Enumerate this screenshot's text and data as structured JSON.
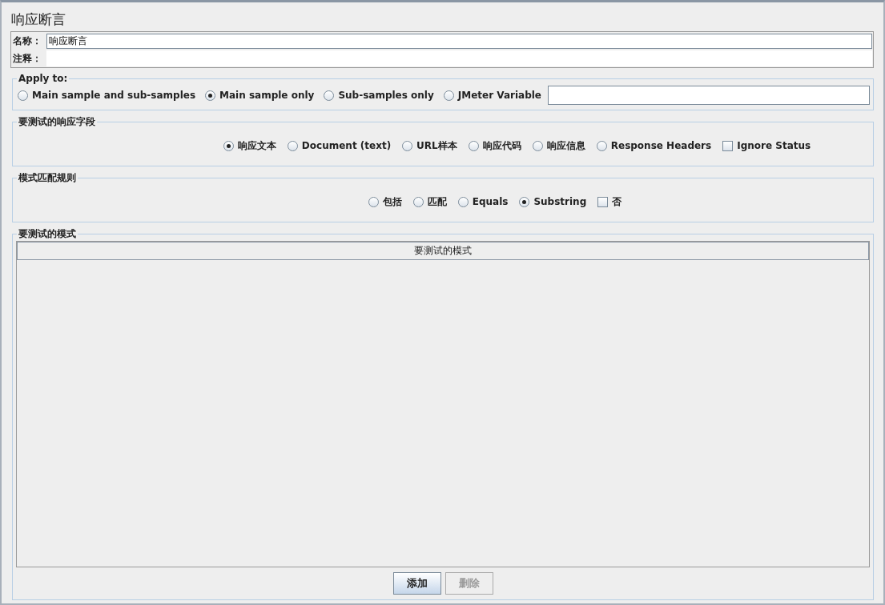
{
  "title": "响应断言",
  "name_field": {
    "label": "名称：",
    "value": "响应断言"
  },
  "comment_field": {
    "label": "注释："
  },
  "apply_to": {
    "legend": "Apply to:",
    "options": [
      {
        "kind": "radio",
        "label": "Main sample and sub-samples",
        "selected": false
      },
      {
        "kind": "radio",
        "label": "Main sample only",
        "selected": true
      },
      {
        "kind": "radio",
        "label": "Sub-samples only",
        "selected": false
      },
      {
        "kind": "radio",
        "label": "JMeter Variable",
        "selected": false
      }
    ]
  },
  "response_field": {
    "legend": "要测试的响应字段",
    "options": [
      {
        "kind": "radio",
        "label": "响应文本",
        "selected": true
      },
      {
        "kind": "radio",
        "label": "Document (text)",
        "selected": false
      },
      {
        "kind": "radio",
        "label": "URL样本",
        "selected": false
      },
      {
        "kind": "radio",
        "label": "响应代码",
        "selected": false
      },
      {
        "kind": "radio",
        "label": "响应信息",
        "selected": false
      },
      {
        "kind": "radio",
        "label": "Response Headers",
        "selected": false
      },
      {
        "kind": "checkbox",
        "label": "Ignore Status",
        "checked": false
      }
    ]
  },
  "pattern_rules": {
    "legend": "模式匹配规则",
    "options": [
      {
        "kind": "radio",
        "label": "包括",
        "selected": false
      },
      {
        "kind": "radio",
        "label": "匹配",
        "selected": false
      },
      {
        "kind": "radio",
        "label": "Equals",
        "selected": false
      },
      {
        "kind": "radio",
        "label": "Substring",
        "selected": true
      },
      {
        "kind": "checkbox",
        "label": "否",
        "checked": false
      }
    ]
  },
  "patterns": {
    "legend": "要测试的模式",
    "columns": [
      "要测试的模式"
    ]
  },
  "buttons": [
    {
      "label": "添加",
      "disabled": false
    },
    {
      "label": "删除",
      "disabled": true
    }
  ]
}
